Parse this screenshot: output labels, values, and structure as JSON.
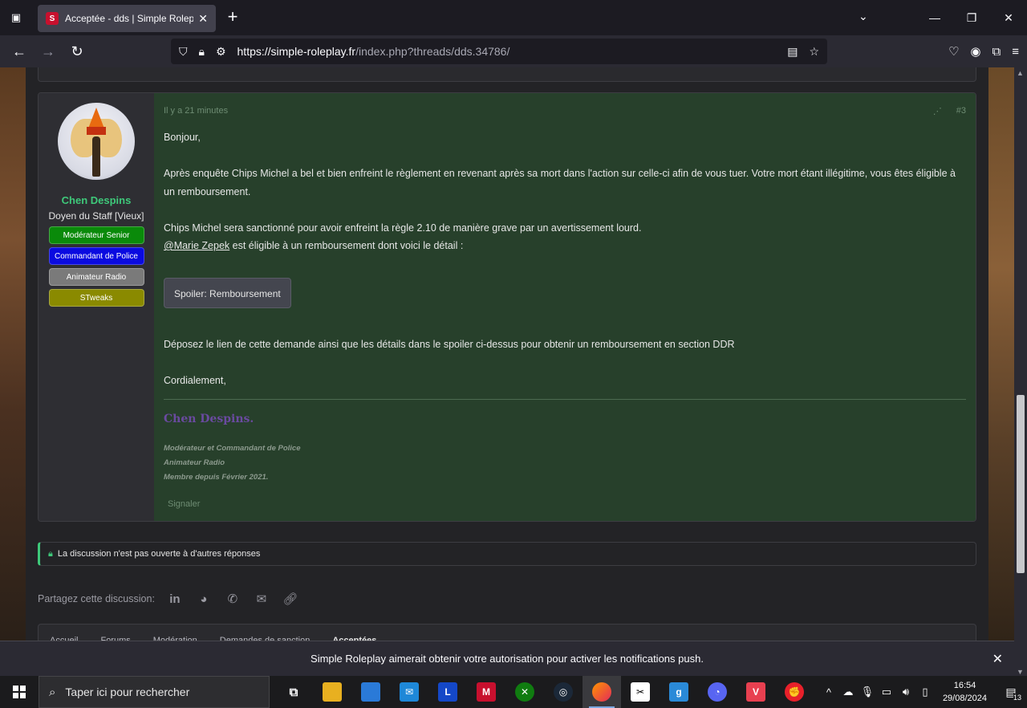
{
  "browser": {
    "tab_title": "Acceptée - dds | Simple Roleplay",
    "favicon_text": "S",
    "url_host": "https://simple-roleplay.fr",
    "url_path": "/index.php?threads/dds.34786/"
  },
  "post": {
    "time": "Il y a 21 minutes",
    "number": "#3",
    "author": {
      "name": "Chen Despins",
      "title": "Doyen du Staff [Vieux]",
      "badges": [
        {
          "label": "Modérateur Senior",
          "bg": "#0a8a0a",
          "fg": "#ffffff"
        },
        {
          "label": "Commandant de Police",
          "bg": "#0a0ae0",
          "fg": "#ffffff"
        },
        {
          "label": "Animateur Radio",
          "bg": "#7a7a7a",
          "fg": "#ffffff"
        },
        {
          "label": "STweaks",
          "bg": "#8a8a00",
          "fg": "#ffffff"
        }
      ]
    },
    "body": {
      "greeting": "Bonjour,",
      "para1": "Après enquête Chips Michel a bel et bien enfreint le règlement en revenant après sa mort dans l'action sur celle-ci afin de vous tuer. Votre mort étant illégitime, vous êtes éligible à un remboursement.",
      "para2": "Chips Michel sera sanctionné pour avoir enfreint la règle 2.10 de manière grave par un avertissement lourd.",
      "mention": "@Marie Zepek",
      "para3_rest": " est éligible à un remboursement dont voici le détail :",
      "spoiler_label": "Spoiler: Remboursement",
      "para4": "Déposez le lien de cette demande ainsi que les détails dans le spoiler ci-dessus pour obtenir un remboursement en section DDR",
      "closing": "Cordialement,"
    },
    "signature": {
      "name": "Chen Despins.",
      "line1": "Modérateur et Commandant de Police",
      "line2": "Animateur Radio",
      "line3": "Membre depuis Février 2021."
    },
    "report_label": "Signaler"
  },
  "thread": {
    "locked_message": "La discussion n'est pas ouverte à d'autres réponses",
    "share_label": "Partagez cette discussion:",
    "breadcrumbs": [
      "Accueil",
      "Forums",
      "Modération",
      "Demandes de sanction",
      "Acceptées"
    ]
  },
  "notification_bar": {
    "message": "Simple Roleplay aimerait obtenir votre autorisation pour activer les notifications push."
  },
  "taskbar": {
    "search_placeholder": "Taper ici pour rechercher",
    "time": "16:54",
    "date": "29/08/2024",
    "notification_count": "13"
  }
}
